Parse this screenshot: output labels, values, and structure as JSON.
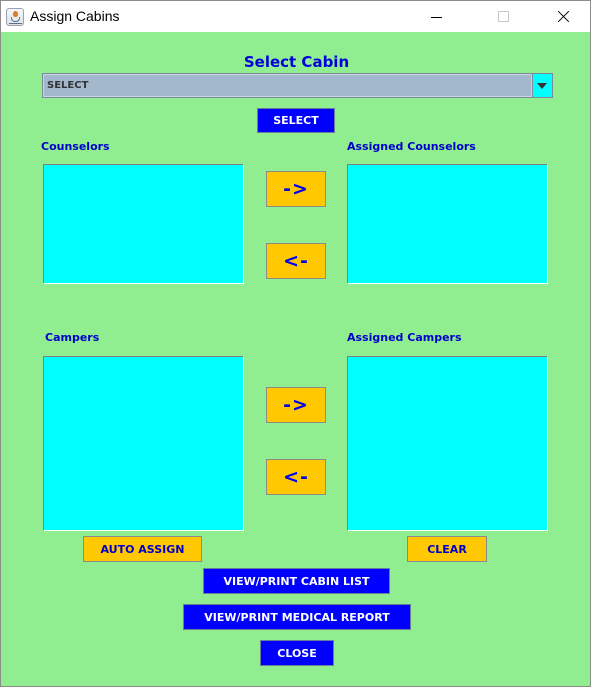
{
  "window": {
    "title": "Assign Cabins",
    "controls": {
      "minimize": "minimize-icon",
      "maximize": "maximize-icon",
      "close": "close-icon"
    },
    "app_icon": "java-cup-icon"
  },
  "colors": {
    "background": "#90EE90",
    "heading_text": "#0000DD",
    "list_background": "#00FFFF",
    "primary_button": "#0000FF",
    "secondary_button": "#FFC800",
    "combo_background": "#A3B8CC"
  },
  "cabin_select": {
    "heading": "Select Cabin",
    "selected_value": "SELECT",
    "select_button": "SELECT"
  },
  "counselors": {
    "available_label": "Counselors",
    "assigned_label": "Assigned Counselors",
    "available_items": [],
    "assigned_items": [],
    "move_right_label": "->",
    "move_left_label": "<-"
  },
  "campers": {
    "available_label": "Campers",
    "assigned_label": "Assigned Campers",
    "available_items": [],
    "assigned_items": [],
    "move_right_label": "->",
    "move_left_label": "<-"
  },
  "actions": {
    "auto_assign": "AUTO ASSIGN",
    "clear": "CLEAR",
    "view_print_cabin_list": "VIEW/PRINT CABIN LIST",
    "view_print_medical_report": "VIEW/PRINT MEDICAL REPORT",
    "close": "CLOSE"
  }
}
